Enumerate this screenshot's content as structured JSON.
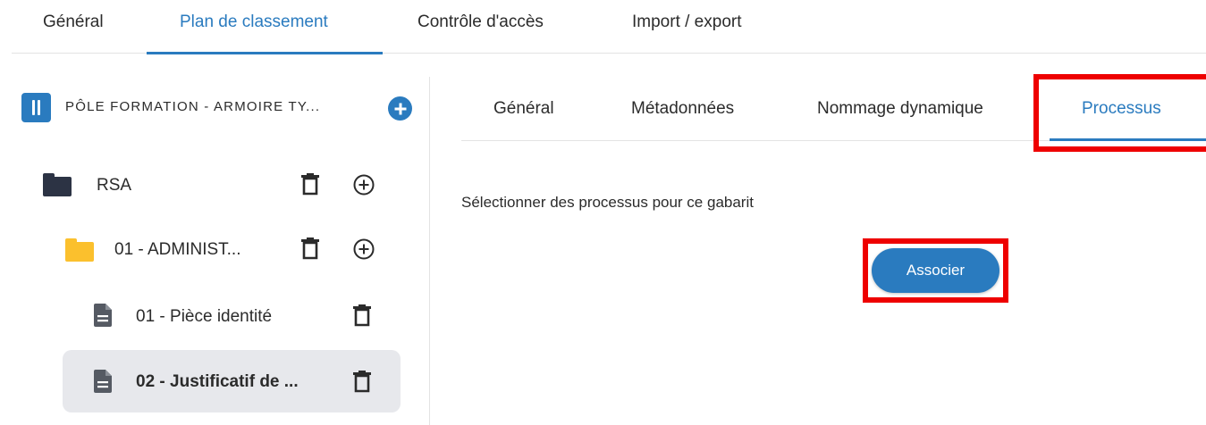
{
  "top_tabs": {
    "items": [
      {
        "label": "Général",
        "active": false
      },
      {
        "label": "Plan de classement",
        "active": true
      },
      {
        "label": "Contrôle d'accès",
        "active": false
      },
      {
        "label": "Import / export",
        "active": false
      }
    ]
  },
  "tree": {
    "root": {
      "label": "PÔLE FORMATION - ARMOIRE TY...",
      "icon": "cabinet-icon",
      "add_icon": "plus-circle-icon"
    },
    "items": [
      {
        "label": "RSA",
        "icon": "folder-icon",
        "icon_color": "#2c3344",
        "level": 0,
        "selected": false
      },
      {
        "label": "01 - ADMINIST...",
        "icon": "folder-icon",
        "icon_color": "#fbc02d",
        "level": 1,
        "selected": false
      },
      {
        "label": "01 - Pièce identité",
        "icon": "file-icon",
        "level": 2,
        "selected": false
      },
      {
        "label": "02 - Justificatif de ...",
        "icon": "file-icon",
        "level": 2,
        "selected": true
      }
    ]
  },
  "inner_tabs": {
    "items": [
      {
        "label": "Général",
        "active": false
      },
      {
        "label": "Métadonnées",
        "active": false
      },
      {
        "label": "Nommage dynamique",
        "active": false
      },
      {
        "label": "Processus",
        "active": true
      }
    ]
  },
  "content": {
    "prompt": "Sélectionner des processus pour ce gabarit",
    "associate_label": "Associer"
  },
  "colors": {
    "accent": "#2a7bbf",
    "highlight": "#ee0000",
    "selected_bg": "#e7e8ec"
  }
}
